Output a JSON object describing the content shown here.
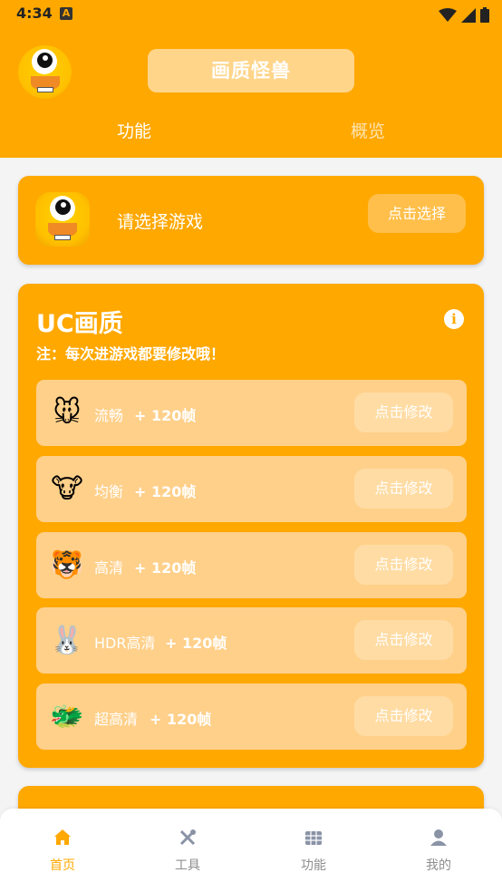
{
  "status_bar": {
    "time": "4:34",
    "a_icon": "A"
  },
  "header": {
    "title": "画质怪兽",
    "tabs": [
      {
        "label": "功能"
      },
      {
        "label": "概览"
      }
    ],
    "active_tab": "功能"
  },
  "game_select": {
    "label": "请选择游戏",
    "button": "点击选择"
  },
  "uc": {
    "title": "UC画质",
    "note": "注：每次进游戏都要修改哦！",
    "info_icon": "i",
    "rows": [
      {
        "icon": "🐭",
        "name": "流畅",
        "fps": "+ 120帧",
        "button": "点击修改"
      },
      {
        "icon": "🐮",
        "name": "均衡",
        "fps": "+ 120帧",
        "button": "点击修改"
      },
      {
        "icon": "🐯",
        "name": "高清",
        "fps": "+ 120帧",
        "button": "点击修改"
      },
      {
        "icon": "🐰",
        "name": "HDR高清",
        "fps": "+ 120帧",
        "button": "点击修改"
      },
      {
        "icon": "🐲",
        "name": "超高清",
        "fps": "+ 120帧",
        "button": "点击修改"
      }
    ]
  },
  "bottom_nav": {
    "items": [
      {
        "label": "首页",
        "icon": "home-icon",
        "active": true
      },
      {
        "label": "工具",
        "icon": "tools-icon",
        "active": false
      },
      {
        "label": "功能",
        "icon": "grid-icon",
        "active": false
      },
      {
        "label": "我的",
        "icon": "person-icon",
        "active": false
      }
    ]
  },
  "colors": {
    "primary": "#ffa800",
    "row_bg": "#ffd08a",
    "background": "#f4f4f4",
    "inactive_nav": "#8e8e8e"
  }
}
